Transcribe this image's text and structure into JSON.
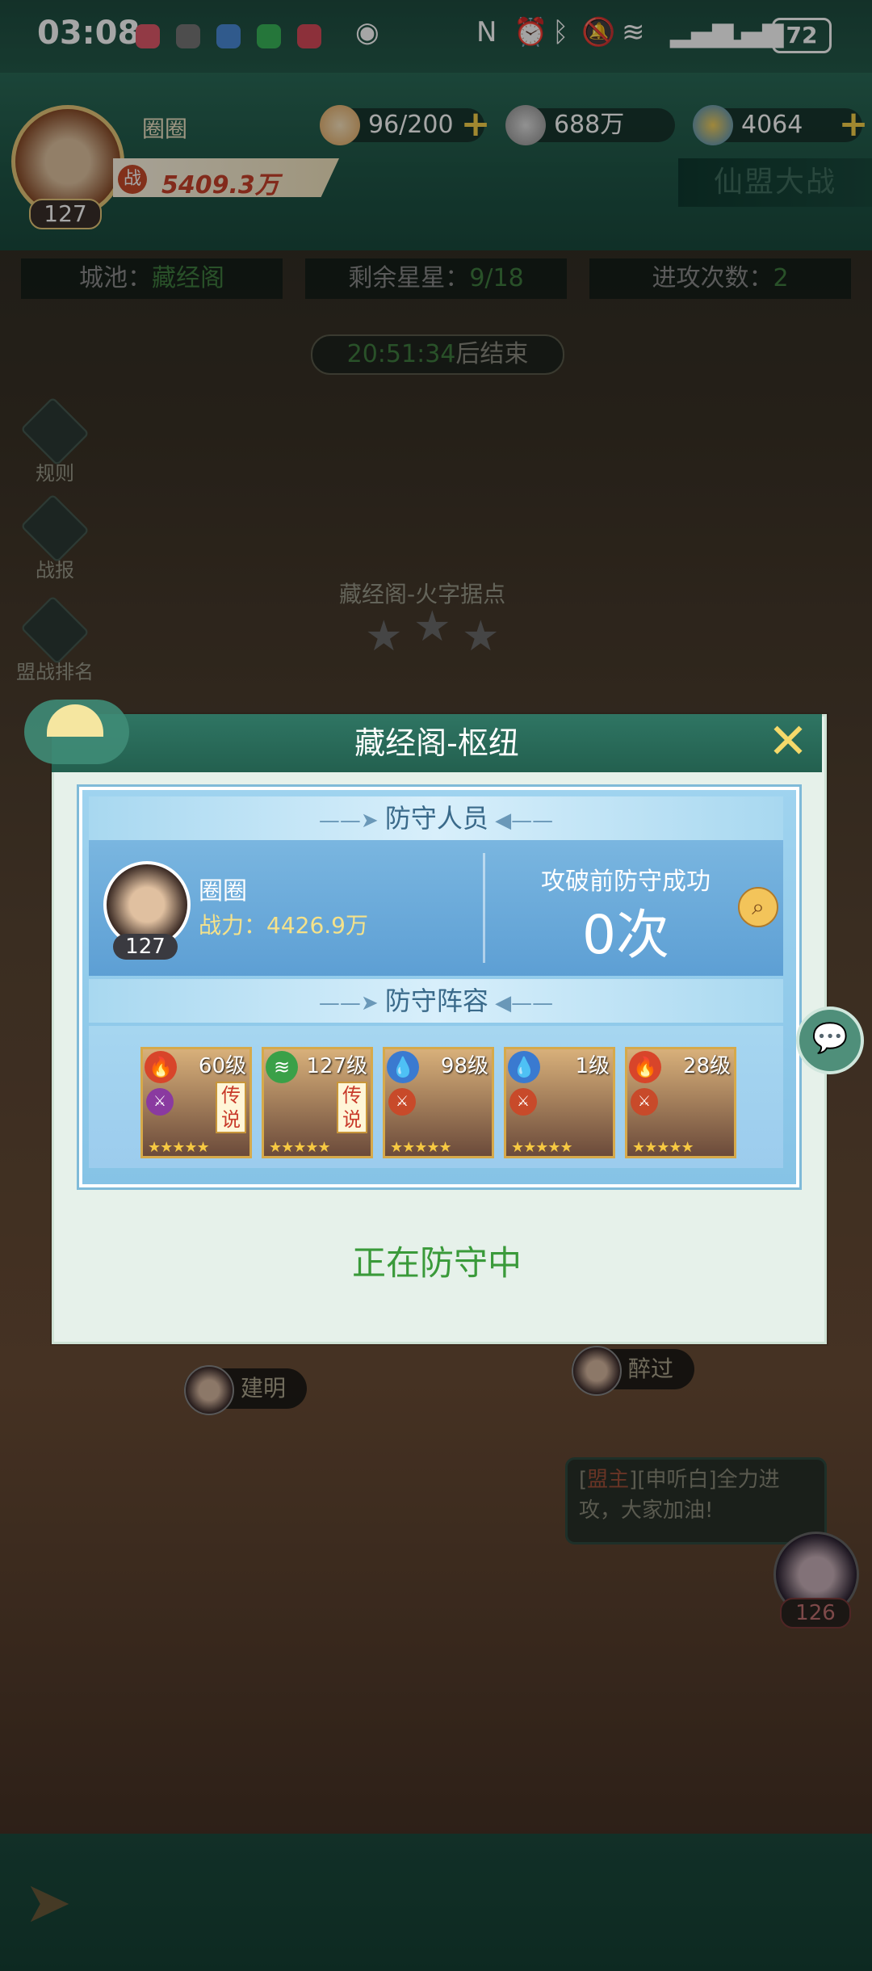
{
  "status_bar": {
    "time": "03:08",
    "battery": "72"
  },
  "header": {
    "player_name": "圈圈",
    "player_level": "127",
    "stamina": "96/200",
    "coins": "688万",
    "jade": "4064",
    "battle_power": "5409.3万",
    "battle_power_icon": "战",
    "mode_title": "仙盟大战"
  },
  "info": {
    "city_label": "城池：",
    "city_value": "藏经阁",
    "stars_label": "剩余星星：",
    "stars_value": "9/18",
    "attacks_label": "进攻次数：",
    "attacks_value": "2",
    "countdown_time": "20:51:34",
    "countdown_suffix": "后结束"
  },
  "side_buttons": [
    {
      "label": "规则",
      "icon": "rules-icon"
    },
    {
      "label": "战报",
      "icon": "battle-report-icon"
    },
    {
      "label": "盟战排名",
      "icon": "ranking-icon"
    }
  ],
  "map": {
    "location_label": "藏经阁-火字据点",
    "location_stars": "3",
    "players": [
      "建明",
      "醉过"
    ],
    "chat_tag_open": "[",
    "chat_tag": "盟主",
    "chat_tag_close": "]",
    "chat_message": "[申听白]全力进攻，大家加油!",
    "leader_level": "126"
  },
  "modal": {
    "title": "藏经阁-枢纽",
    "close": "✕",
    "section_defenders": "防守人员",
    "section_lineup": "防守阵容",
    "defender": {
      "name": "圈圈",
      "power_label": "战力：",
      "power_value": "4426.9万",
      "level": "127"
    },
    "success_label": "攻破前防守成功",
    "success_value": "0次",
    "heroes": [
      {
        "level": "60级",
        "element": "fire",
        "legend": "传说",
        "stars": 5
      },
      {
        "level": "127级",
        "element": "wind",
        "legend": "传说",
        "stars": 5
      },
      {
        "level": "98级",
        "element": "water",
        "legend": "",
        "stars": 5
      },
      {
        "level": "1级",
        "element": "water",
        "legend": "",
        "stars": 5
      },
      {
        "level": "28级",
        "element": "fire",
        "legend": "",
        "stars": 5
      }
    ],
    "status": "正在防守中"
  },
  "colors": {
    "header_green": "#23604f",
    "accent_green": "#3a9a3a",
    "power_red": "#c8412a",
    "gold": "#f5d96a"
  }
}
